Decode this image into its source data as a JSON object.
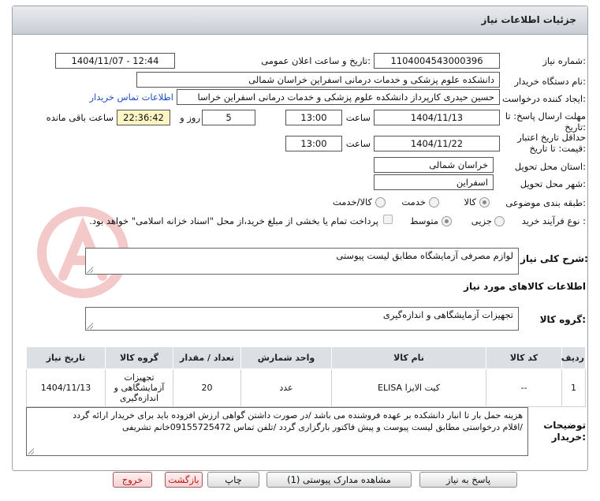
{
  "header": {
    "title": "جزئیات اطلاعات نیاز"
  },
  "form": {
    "need_number_label": "شماره نیاز:",
    "need_number": "1104004543000396",
    "announce_label": "تاریخ و ساعت اعلان عمومی:",
    "announce_value": "1404/11/07 - 12:44",
    "buyer_org_label": "نام دستگاه خریدار:",
    "buyer_org": "دانشکده علوم پزشکی و خدمات درمانی اسفراین خراسان شمالی",
    "creator_label": "ایجاد کننده درخواست:",
    "creator": "حسین  حیدری کارپرداز دانشکده علوم پزشکی و خدمات درمانی اسفراین خراسا",
    "contact_link": "اطلاعات تماس خریدار",
    "send_deadline_label_1": "مهلت ارسال پاسخ: تا",
    "send_deadline_label_2": "تاریخ:",
    "send_date": "1404/11/13",
    "time_label": "ساعت",
    "send_time": "13:00",
    "days": "5",
    "days_label": "روز و",
    "remaining_time": "22:36:42",
    "remaining_label": "ساعت باقی مانده",
    "validity_label_1": "حداقل تاریخ اعتبار",
    "validity_label_2": "قیمت: تا تاریخ:",
    "validity_date": "1404/11/22",
    "validity_time": "13:00",
    "province_label": "استان محل تحویل:",
    "province": "خراسان شمالی",
    "city_label": "شهر محل تحویل:",
    "city": "اسفراین",
    "category_label": "طبقه بندی موضوعی:",
    "category_options": [
      "کالا",
      "خدمت",
      "کالا/خدمت"
    ],
    "process_label": "نوع فرآیند خرید :",
    "process_options": [
      "جزیی",
      "متوسط"
    ],
    "payment_note": "پرداخت تمام یا بخشی از مبلغ خرید،از محل \"اسناد خزانه اسلامی\" خواهد بود."
  },
  "description": {
    "label": "شرح کلی نیاز:",
    "value": "لوازم مصرفی آزمایشگاه مطابق لیست پیوستی"
  },
  "goods": {
    "section_title": "اطلاعات کالاهای مورد نیاز",
    "group_label": "گروه کالا:",
    "group_value": "تجهیزات آزمایشگاهی و اندازه‌گیری",
    "table": {
      "headers": [
        "ردیف",
        "کد کالا",
        "نام کالا",
        "واحد شمارش",
        "تعداد / مقدار",
        "گروه کالا",
        "تاریخ نیاز"
      ],
      "rows": [
        [
          "1",
          "--",
          "کیت الایزا ELISA",
          "عدد",
          "20",
          "تجهیزات آزمایشگاهی و اندازه‌گیری",
          "1404/11/13"
        ]
      ]
    }
  },
  "notes": {
    "label_1": "توضیحات",
    "label_2": "خریدار:",
    "line_1": "هزینه حمل بار تا انبار دانشکده بر عهده فروشنده می باشد /در صورت داشتن گواهی ارزش افزوده باید برای خریدار ارائه گردد",
    "line_2": "/اقلام درخواستی مطابق لیست پیوست و پیش فاکتور بارگزاری گردد /تلفن تماس 09155725472خانم تشریفی"
  },
  "buttons": {
    "reply": "پاسخ به نیاز",
    "attachments": "مشاهده مدارک پیوستی (1)",
    "print": "چاپ",
    "back": "بازگشت",
    "exit": "خروج"
  }
}
